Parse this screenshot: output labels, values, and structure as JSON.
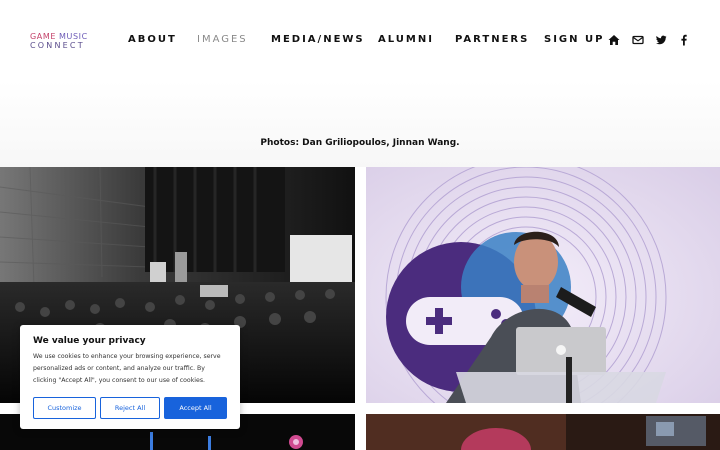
{
  "logo": {
    "line1_a": "GAME",
    "line1_b": "MUSIC",
    "line2": "CONNECT"
  },
  "nav": {
    "items": [
      {
        "label": "ABOUT"
      },
      {
        "label": "IMAGES",
        "active": true
      },
      {
        "label": "MEDIA/NEWS"
      },
      {
        "label": "ALUMNI"
      },
      {
        "label": "PARTNERS"
      },
      {
        "label": "SIGN UP"
      }
    ],
    "icons": [
      "home-icon",
      "envelope-icon",
      "twitter-icon",
      "facebook-icon"
    ]
  },
  "credit": "Photos: Dan Griliopoulos, Jinnan Wang.",
  "gallery": {
    "photos": [
      "concert-hall-audience-photo",
      "speaker-at-podium-photo",
      "stage-performance-photo",
      "performer-closeup-photo"
    ]
  },
  "cookie": {
    "title": "We value your privacy",
    "text": "We use cookies to enhance your browsing experience, serve personalized ads or content, and analyze our traffic. By clicking \"Accept All\", you consent to our use of cookies.",
    "customize": "Customize",
    "reject": "Reject All",
    "accept": "Accept All"
  },
  "colors": {
    "accent": "#1863dc",
    "logo_pink": "#c4436b",
    "logo_purple": "#6d5bb7"
  }
}
